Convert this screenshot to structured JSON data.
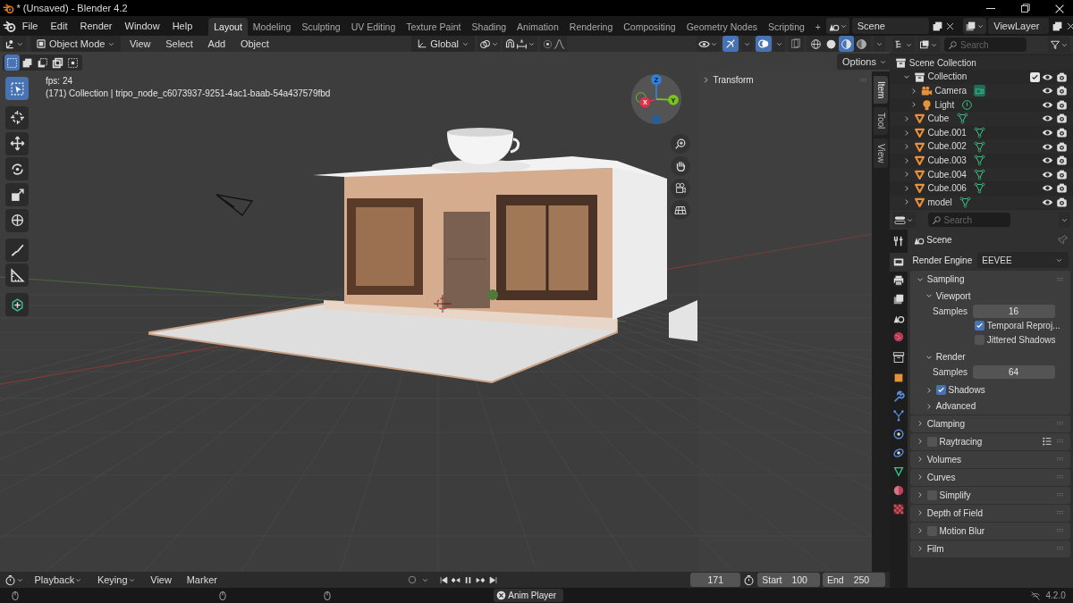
{
  "window": {
    "title": "* (Unsaved) - Blender 4.2"
  },
  "menus": [
    "File",
    "Edit",
    "Render",
    "Window",
    "Help"
  ],
  "workspaces": [
    {
      "label": "Layout",
      "selected": true
    },
    {
      "label": "Modeling",
      "selected": false
    },
    {
      "label": "Sculpting",
      "selected": false
    },
    {
      "label": "UV Editing",
      "selected": false
    },
    {
      "label": "Texture Paint",
      "selected": false
    },
    {
      "label": "Shading",
      "selected": false
    },
    {
      "label": "Animation",
      "selected": false
    },
    {
      "label": "Rendering",
      "selected": false
    },
    {
      "label": "Compositing",
      "selected": false
    },
    {
      "label": "Geometry Nodes",
      "selected": false
    },
    {
      "label": "Scripting",
      "selected": false
    }
  ],
  "add_workspace": "+",
  "scene": "Scene",
  "view_layer": "ViewLayer",
  "viewport": {
    "mode": "Object Mode",
    "menus": [
      "View",
      "Select",
      "Add",
      "Object"
    ],
    "orientation": "Global",
    "select_modes": [
      {
        "kind": "set",
        "selected": true
      },
      {
        "kind": "extend",
        "selected": false
      },
      {
        "kind": "subtract",
        "selected": false
      },
      {
        "kind": "invert",
        "selected": false
      },
      {
        "kind": "intersect",
        "selected": false
      }
    ],
    "toggles": [
      {
        "kind": "gizmos",
        "on": true
      },
      {
        "kind": "overlays",
        "on": true
      },
      {
        "kind": "xray",
        "on": false
      }
    ],
    "shading": [
      {
        "kind": "wireframe",
        "selected": false
      },
      {
        "kind": "solid",
        "selected": false
      },
      {
        "kind": "material",
        "selected": true
      },
      {
        "kind": "rendered",
        "selected": false
      }
    ],
    "options": "Options",
    "fps": "fps: 24",
    "info": "(171) Collection | tripo_node_c6073937-9251-4ac1-baab-54a437579fbd",
    "tools": [
      {
        "kind": "select",
        "selected": true
      },
      {
        "kind": "cursor",
        "selected": false
      },
      {
        "kind": "move",
        "selected": false
      },
      {
        "kind": "rotate",
        "selected": false
      },
      {
        "kind": "scale",
        "selected": false
      },
      {
        "kind": "transform",
        "selected": false
      },
      {
        "kind": "annotate",
        "selected": false
      },
      {
        "kind": "measure",
        "selected": false
      },
      {
        "kind": "add_cube",
        "selected": false
      }
    ],
    "gizmo_axes": [
      "Z",
      "X",
      "Y"
    ],
    "transform_panel": "Transform",
    "sidebar_tabs": [
      {
        "label": "Item",
        "selected": true
      },
      {
        "label": "Tool",
        "selected": false
      },
      {
        "label": "View",
        "selected": false
      }
    ]
  },
  "outliner": {
    "search_placeholder": "Search",
    "tree": [
      {
        "label": "Scene Collection",
        "kind": "scene_collection",
        "children": [
          {
            "label": "Collection",
            "kind": "collection",
            "expanded": true,
            "checked": true,
            "children": [
              {
                "label": "Camera",
                "kind": "camera",
                "expanded": false
              },
              {
                "label": "Light",
                "kind": "light",
                "expanded": false
              }
            ]
          },
          {
            "label": "Cube",
            "kind": "mesh",
            "expanded": false
          },
          {
            "label": "Cube.001",
            "kind": "mesh",
            "expanded": false
          },
          {
            "label": "Cube.002",
            "kind": "mesh",
            "expanded": false
          },
          {
            "label": "Cube.003",
            "kind": "mesh",
            "expanded": false
          },
          {
            "label": "Cube.004",
            "kind": "mesh",
            "expanded": false
          },
          {
            "label": "Cube.006",
            "kind": "mesh",
            "expanded": false
          },
          {
            "label": "model",
            "kind": "mesh",
            "expanded": false
          }
        ]
      }
    ]
  },
  "properties": {
    "search_placeholder": "Search",
    "context": "Scene",
    "tabs": [
      {
        "kind": "tool",
        "selected": false
      },
      {
        "kind": "render",
        "selected": true
      },
      {
        "kind": "output",
        "selected": false
      },
      {
        "kind": "view_layer",
        "selected": false
      },
      {
        "kind": "scene",
        "selected": false
      },
      {
        "kind": "world",
        "selected": false
      },
      {
        "kind": "collection",
        "selected": false
      },
      {
        "kind": "object",
        "selected": false
      },
      {
        "kind": "modifier",
        "selected": false
      },
      {
        "kind": "particles",
        "selected": false
      },
      {
        "kind": "physics",
        "selected": false
      },
      {
        "kind": "constraints",
        "selected": false
      },
      {
        "kind": "data",
        "selected": false
      },
      {
        "kind": "material",
        "selected": false
      },
      {
        "kind": "texture",
        "selected": false
      }
    ],
    "render_engine_label": "Render Engine",
    "render_engine": "EEVEE",
    "panels": [
      {
        "label": "Sampling",
        "expanded": true,
        "children": [
          {
            "label": "Viewport",
            "expanded": true,
            "fields": [
              {
                "kind": "number",
                "label": "Samples",
                "value": "16"
              },
              {
                "kind": "checkbox",
                "label": "Temporal Reproj...",
                "checked": true
              },
              {
                "kind": "checkbox",
                "label": "Jittered Shadows",
                "checked": false
              }
            ]
          },
          {
            "label": "Render",
            "expanded": true,
            "fields": [
              {
                "kind": "number",
                "label": "Samples",
                "value": "64"
              }
            ]
          },
          {
            "label": "Shadows",
            "expanded": false,
            "checked": true
          },
          {
            "label": "Advanced",
            "expanded": false
          }
        ]
      },
      {
        "label": "Clamping",
        "expanded": false
      },
      {
        "label": "Raytracing",
        "expanded": false,
        "checked": false,
        "presets": true
      },
      {
        "label": "Volumes",
        "expanded": false
      },
      {
        "label": "Curves",
        "expanded": false
      },
      {
        "label": "Simplify",
        "expanded": false,
        "checked": false
      },
      {
        "label": "Depth of Field",
        "expanded": false
      },
      {
        "label": "Motion Blur",
        "expanded": false,
        "checked": false
      },
      {
        "label": "Film",
        "expanded": false
      }
    ]
  },
  "timeline": {
    "menus": [
      {
        "label": "Playback",
        "dropdown": true
      },
      {
        "label": "Keying",
        "dropdown": true
      },
      {
        "label": "View",
        "dropdown": false
      },
      {
        "label": "Marker",
        "dropdown": false
      }
    ],
    "current_frame": "171",
    "start_label": "Start",
    "start": "100",
    "end_label": "End",
    "end": "250"
  },
  "status_bar": {
    "center": "Anim Player",
    "version": "4.2.0"
  }
}
